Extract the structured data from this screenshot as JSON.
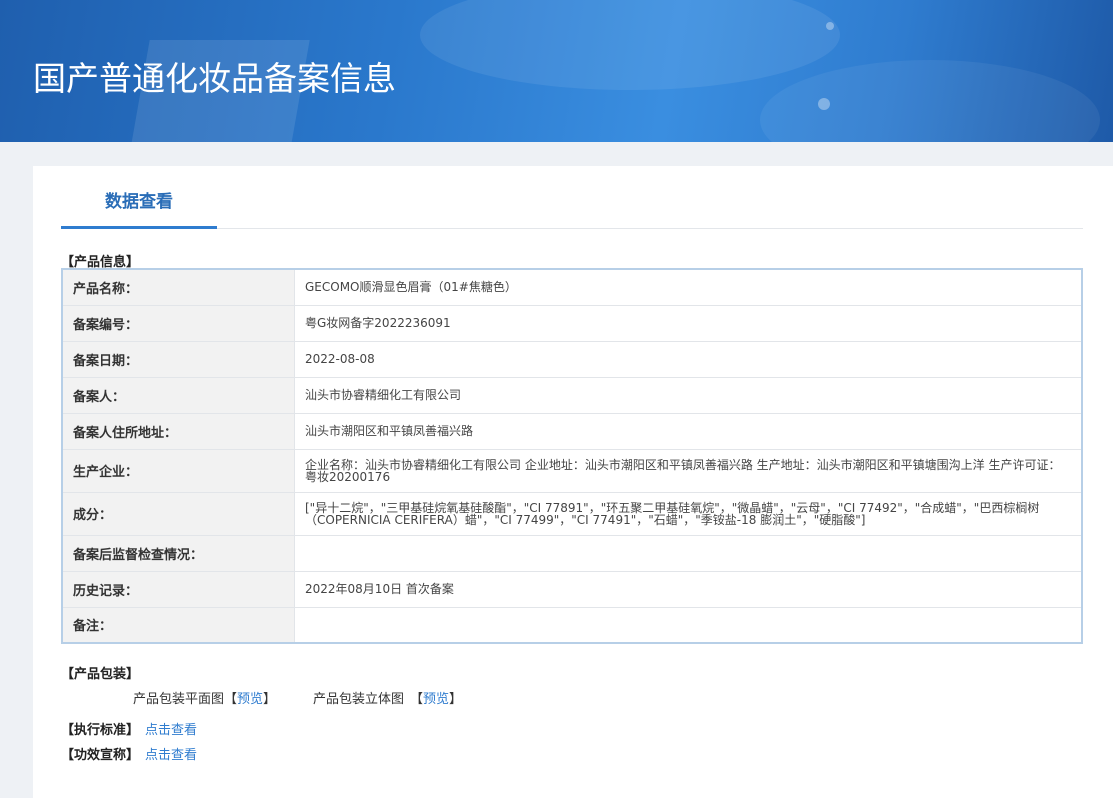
{
  "header": {
    "title": "国产普通化妆品备案信息"
  },
  "tabs": [
    {
      "label": "数据查看"
    }
  ],
  "product_info": {
    "section_title": "【产品信息】",
    "rows": [
      {
        "label": "产品名称：",
        "value": "GECOMO顺滑显色眉膏（01#焦糖色）"
      },
      {
        "label": "备案编号：",
        "value": "粤G妆网备字2022236091"
      },
      {
        "label": "备案日期：",
        "value": "2022-08-08"
      },
      {
        "label": "备案人：",
        "value": "汕头市协睿精细化工有限公司"
      },
      {
        "label": "备案人住所地址：",
        "value": "汕头市潮阳区和平镇凤善福兴路"
      },
      {
        "label": "生产企业：",
        "value": "企业名称：汕头市协睿精细化工有限公司 企业地址：汕头市潮阳区和平镇凤善福兴路 生产地址：汕头市潮阳区和平镇塘围沟上洋 生产许可证：粤妆20200176"
      },
      {
        "label": "成分：",
        "value": "[\"异十二烷\"，\"三甲基硅烷氧基硅酸酯\"，\"CI 77891\"，\"环五聚二甲基硅氧烷\"，\"微晶蜡\"，\"云母\"，\"CI 77492\"，\"合成蜡\"，\"巴西棕榈树（COPERNICIA CERIFERA）蜡\"，\"CI 77499\"，\"CI 77491\"，\"石蜡\"，\"季铵盐-18 膨润土\"，\"硬脂酸\"]"
      },
      {
        "label": "备案后监督检查情况：",
        "value": ""
      },
      {
        "label": "历史记录：",
        "value": "2022年08月10日 首次备案"
      },
      {
        "label": "备注：",
        "value": ""
      }
    ]
  },
  "packaging": {
    "section_title": "【产品包装】",
    "flat_label": "产品包装平面图",
    "solid_label": "产品包装立体图",
    "bracket_open": "【",
    "bracket_close": "】",
    "preview_link": "预览"
  },
  "standard": {
    "label": "【执行标准】",
    "link": "点击查看"
  },
  "efficacy": {
    "label": "【功效宣称】",
    "link": "点击查看"
  }
}
